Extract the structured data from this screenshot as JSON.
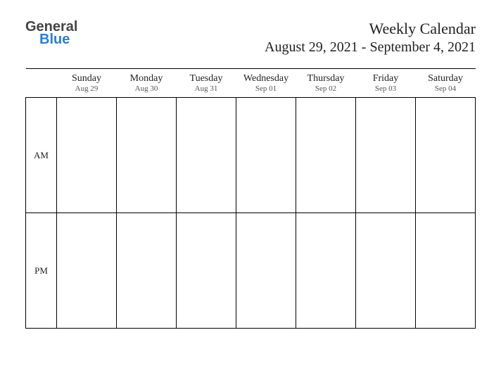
{
  "logo": {
    "part1": "General",
    "part2": "Blue"
  },
  "title": "Weekly Calendar",
  "date_range": "August 29, 2021 - September 4, 2021",
  "days": [
    {
      "name": "Sunday",
      "date": "Aug 29"
    },
    {
      "name": "Monday",
      "date": "Aug 30"
    },
    {
      "name": "Tuesday",
      "date": "Aug 31"
    },
    {
      "name": "Wednesday",
      "date": "Sep 01"
    },
    {
      "name": "Thursday",
      "date": "Sep 02"
    },
    {
      "name": "Friday",
      "date": "Sep 03"
    },
    {
      "name": "Saturday",
      "date": "Sep 04"
    }
  ],
  "periods": [
    "AM",
    "PM"
  ]
}
